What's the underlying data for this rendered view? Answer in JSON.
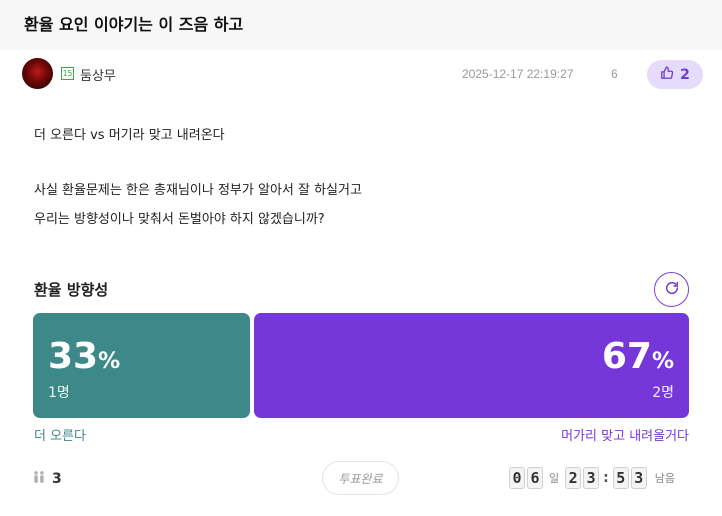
{
  "post": {
    "title": "환율 요인 이야기는 이 즈음 하고",
    "author_level": "15",
    "author": "둠상무",
    "date": "2025-12-17 22:19:27",
    "views": "6",
    "likes": "2"
  },
  "content": {
    "line1": "더 오른다 vs 머기라 맞고 내려온다",
    "line2": "사실 환율문제는 한은 총재님이나 정부가 알아서 잘 하실거고",
    "line3": "우리는 방향성이나 맞춰서 돈벌아야 하지 않겠습니까?"
  },
  "poll": {
    "title": "환율 방향성",
    "options": [
      {
        "label": "더 오른다",
        "percent": "33",
        "count": "1명",
        "color": "#3d8888"
      },
      {
        "label": "머가리 맞고 내려올거다",
        "percent": "67",
        "count": "2명",
        "color": "#7637d9"
      }
    ],
    "percent_sign": "%",
    "voters": "3",
    "status_button": "투표완료",
    "timer": {
      "days": [
        "0",
        "6"
      ],
      "day_unit": "일",
      "hours": [
        "2",
        "3"
      ],
      "minutes": [
        "5",
        "3"
      ],
      "colon": ":",
      "suffix": "남음"
    }
  },
  "colors": {
    "accent": "#7637d9",
    "teal": "#3d8888",
    "like_bg": "#e5dbfa"
  },
  "icons": {
    "like": "thumbs-up-icon",
    "refresh": "refresh-icon",
    "voters": "people-icon"
  }
}
